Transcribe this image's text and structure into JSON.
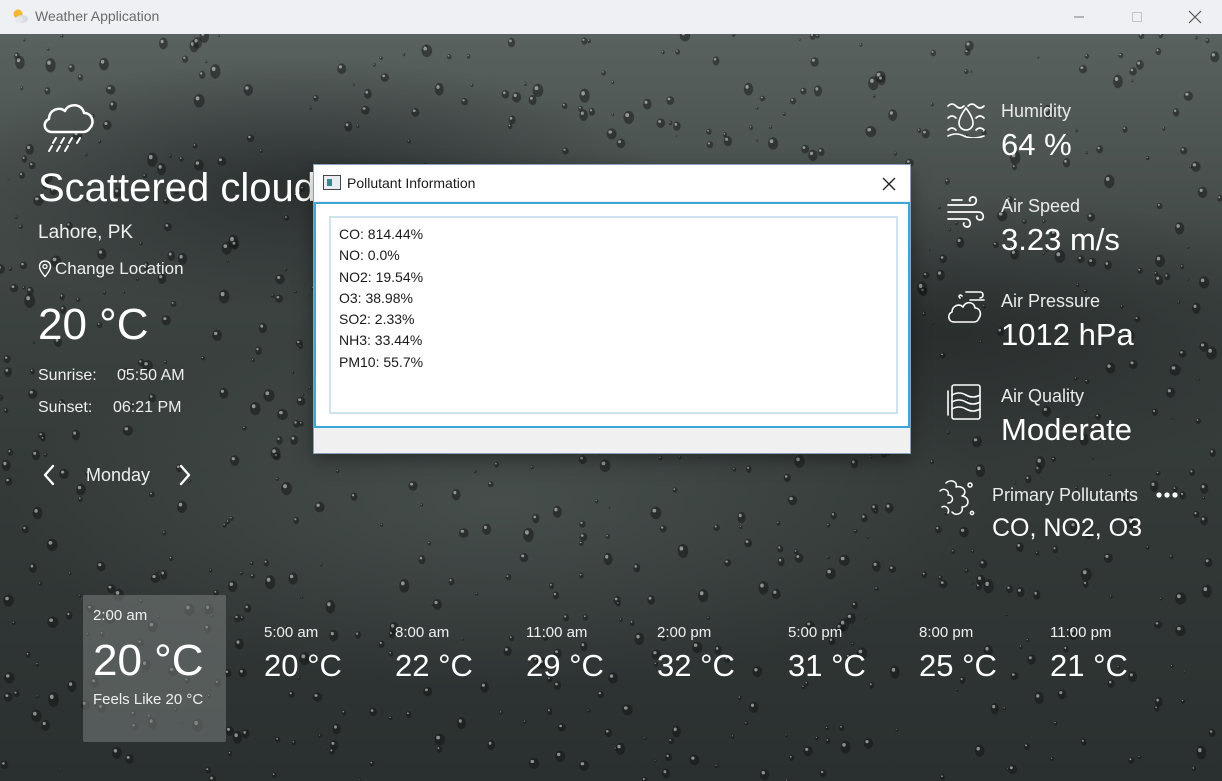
{
  "window": {
    "title": "Weather Application",
    "minimize_icon": "minimize-icon",
    "maximize_icon": "maximize-icon",
    "close_icon": "close-icon"
  },
  "current": {
    "condition": "Scattered cloud",
    "location": "Lahore, PK",
    "change_location": "Change Location",
    "temperature": "20 °C",
    "sunrise_label": "Sunrise:",
    "sunrise_value": "05:50 AM",
    "sunset_label": "Sunset:",
    "sunset_value": "06:21 PM"
  },
  "day_nav": {
    "day": "Monday",
    "prev_icon": "chevron-left-icon",
    "next_icon": "chevron-right-icon"
  },
  "stats": {
    "humidity_label": "Humidity",
    "humidity_value": "64 %",
    "air_speed_label": "Air Speed",
    "air_speed_value": "3.23 m/s",
    "air_pressure_label": "Air Pressure",
    "air_pressure_value": "1012 hPa",
    "air_quality_label": "Air Quality",
    "air_quality_value": "Moderate",
    "pollutants_label": "Primary Pollutants",
    "pollutants_value": "CO, NO2, O3"
  },
  "hourly": [
    {
      "time": "2:00 am",
      "temp": "20 °C",
      "feels_like": "Feels Like 20 °C",
      "active": true
    },
    {
      "time": "5:00 am",
      "temp": "20 °C"
    },
    {
      "time": "8:00 am",
      "temp": "22 °C"
    },
    {
      "time": "11:00 am",
      "temp": "29 °C"
    },
    {
      "time": "2:00 pm",
      "temp": "32 °C"
    },
    {
      "time": "5:00 pm",
      "temp": "31 °C"
    },
    {
      "time": "8:00 pm",
      "temp": "25 °C"
    },
    {
      "time": "11:00 pm",
      "temp": "21 °C"
    }
  ],
  "dialog": {
    "title": "Pollutant Information",
    "lines": [
      "CO: 814.44%",
      "NO: 0.0%",
      "NO2: 19.54%",
      "O3: 38.98%",
      "SO2: 2.33%",
      "NH3: 33.44%",
      "PM10: 55.7%"
    ]
  },
  "colors": {
    "titlebar_bg": "#eef0f3",
    "dialog_border_accent": "#3aa7d8",
    "text_primary": "#ffffff"
  }
}
